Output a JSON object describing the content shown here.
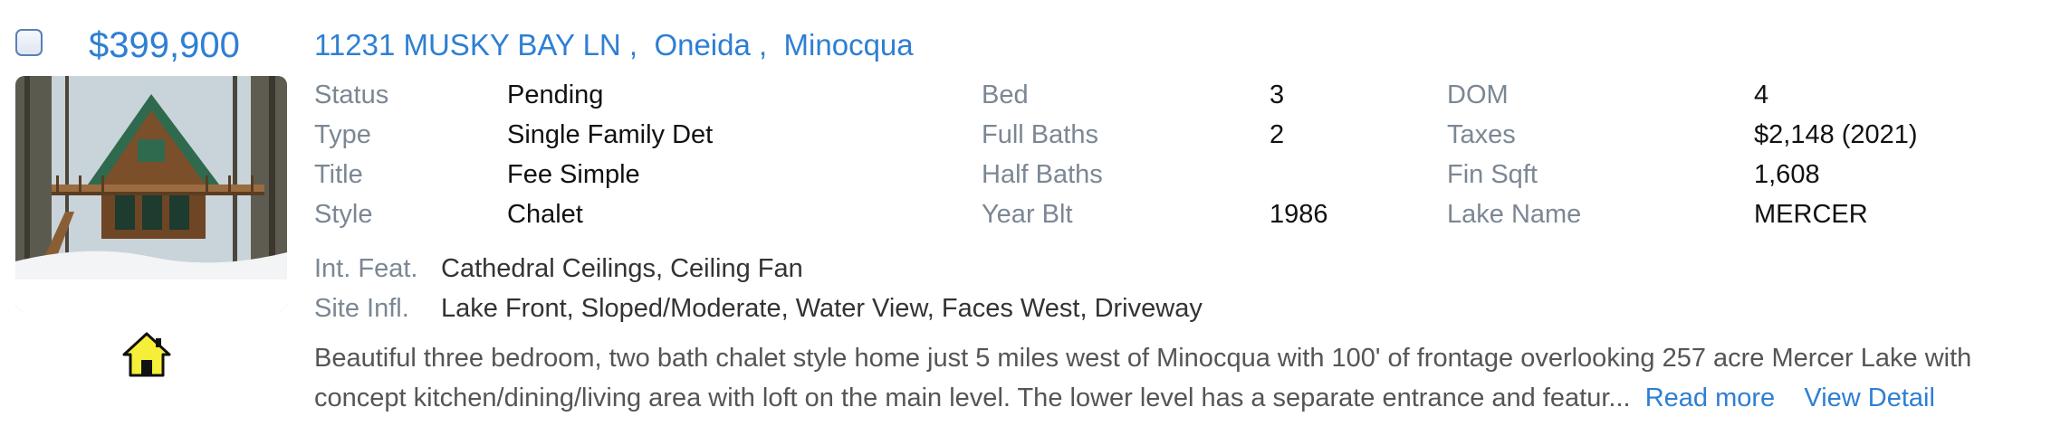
{
  "listing": {
    "price": "$399,900",
    "address": {
      "street": "11231 MUSKY BAY LN",
      "county": "Oneida",
      "city": "Minocqua"
    },
    "sep": " ,  "
  },
  "details": {
    "col1": [
      {
        "label": "Status",
        "value": "Pending"
      },
      {
        "label": "Type",
        "value": "Single Family Det"
      },
      {
        "label": "Title",
        "value": "Fee Simple"
      },
      {
        "label": "Style",
        "value": "Chalet"
      }
    ],
    "col2": [
      {
        "label": "Bed",
        "value": "3"
      },
      {
        "label": "Full Baths",
        "value": "2"
      },
      {
        "label": "Half Baths",
        "value": ""
      },
      {
        "label": "Year Blt",
        "value": "1986"
      }
    ],
    "col3": [
      {
        "label": "DOM",
        "value": "4"
      },
      {
        "label": "Taxes",
        "value": "$2,148  (2021)"
      },
      {
        "label": "Fin Sqft",
        "value": "1,608"
      },
      {
        "label": "Lake Name",
        "value": "MERCER"
      }
    ]
  },
  "features": {
    "int": {
      "label": "Int. Feat.",
      "value": "Cathedral Ceilings, Ceiling Fan"
    },
    "site": {
      "label": "Site Infl.",
      "value": "Lake Front, Sloped/Moderate, Water View, Faces West, Driveway"
    }
  },
  "description": {
    "line1": "Beautiful three bedroom, two bath chalet style home just 5 miles west of Minocqua with 100' of frontage overlooking 257 acre Mercer Lake with",
    "line2": "concept kitchen/dining/living area with loft on the main level. The lower level has a separate entrance and featur...",
    "read_more": "Read more",
    "view_detail": "View Detail"
  },
  "icons": {
    "checkbox": "checkbox-icon",
    "home": "home-icon"
  },
  "colors": {
    "link": "#2e7fd3",
    "label": "#7b8794",
    "home_fill": "#f5ef3a"
  }
}
